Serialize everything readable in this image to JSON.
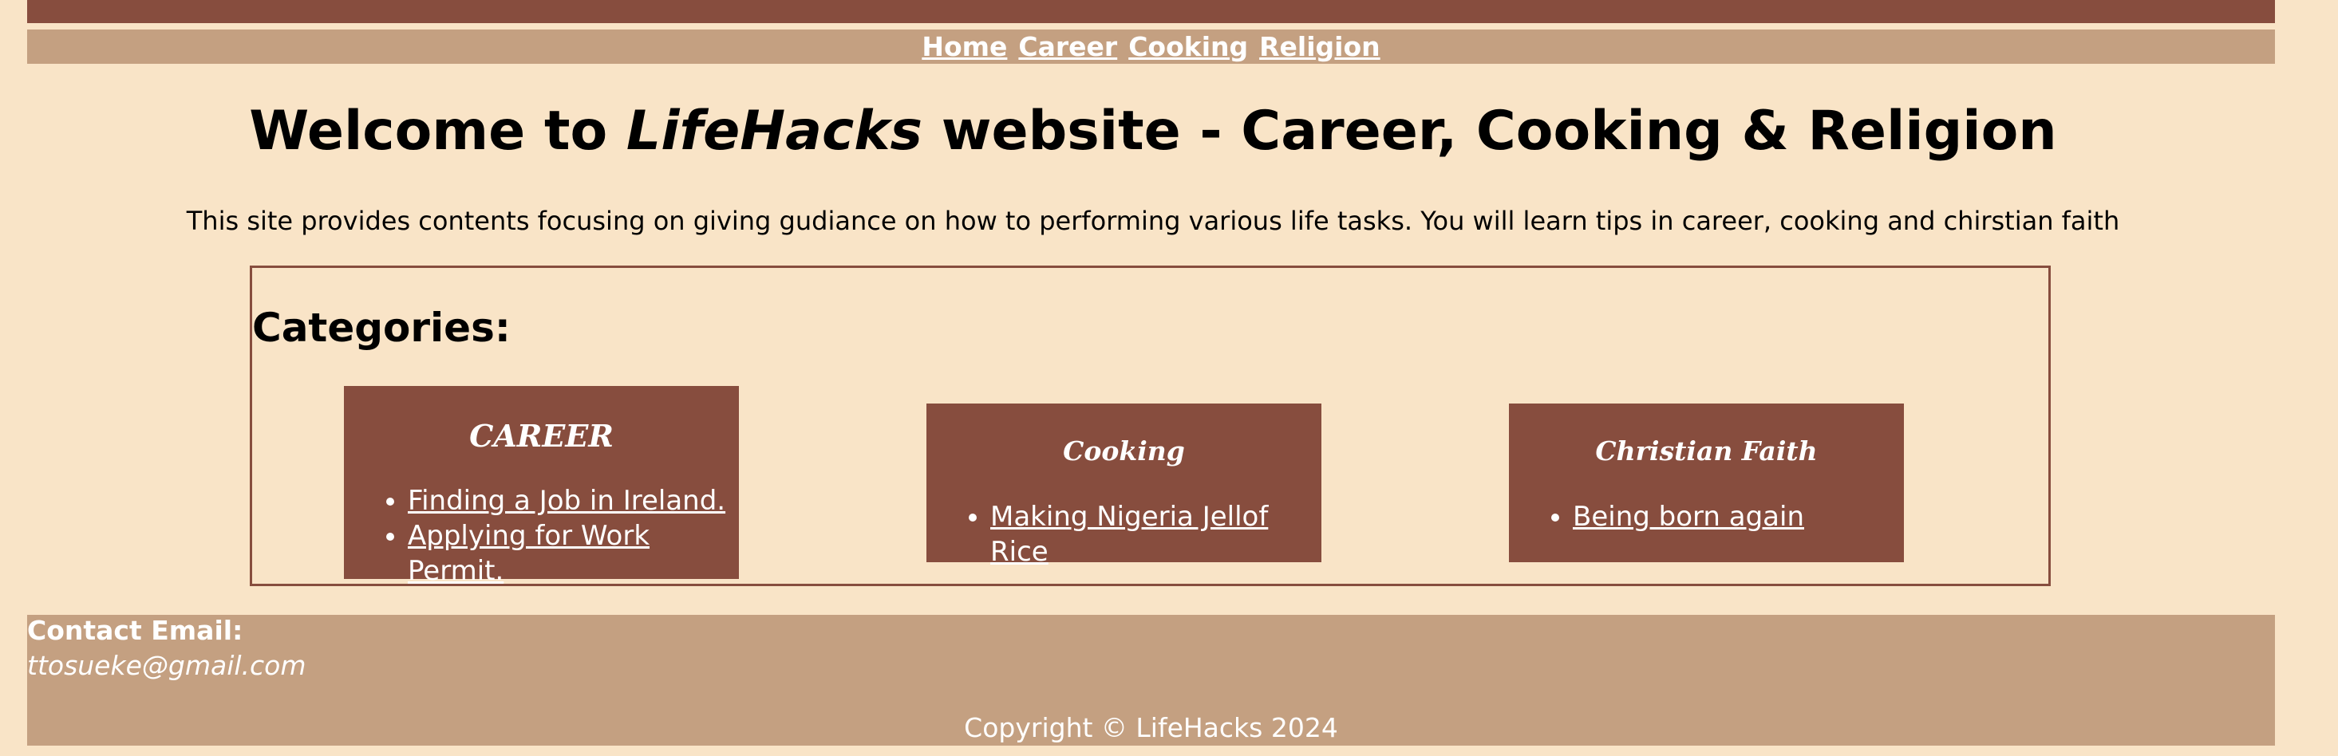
{
  "nav": {
    "items": [
      "Home",
      "Career",
      "Cooking",
      "Religion"
    ]
  },
  "header": {
    "title_before": "Welcome to ",
    "title_em": "LifeHacks",
    "title_after": " website - Career, Cooking & Religion",
    "intro": "This site provides contents focusing on giving gudiance on how to performing various life tasks. You will learn tips in career, cooking and chirstian faith"
  },
  "categories": {
    "heading": "Categories:",
    "career": {
      "title": "CAREER",
      "links": [
        "Finding a Job in Ireland.",
        "Applying for Work Permit."
      ]
    },
    "cooking": {
      "title": "Cooking",
      "links": [
        "Making Nigeria Jellof Rice"
      ]
    },
    "faith": {
      "title": "Christian Faith",
      "links": [
        "Being born again"
      ]
    }
  },
  "footer": {
    "contact_label": "Contact Email:",
    "contact_email": "ttosueke@gmail.com",
    "copyright": "Copyright © LifeHacks 2024"
  },
  "colors": {
    "background": "#f9e4c7",
    "brown": "#874d3e",
    "tan": "#c4a081"
  }
}
